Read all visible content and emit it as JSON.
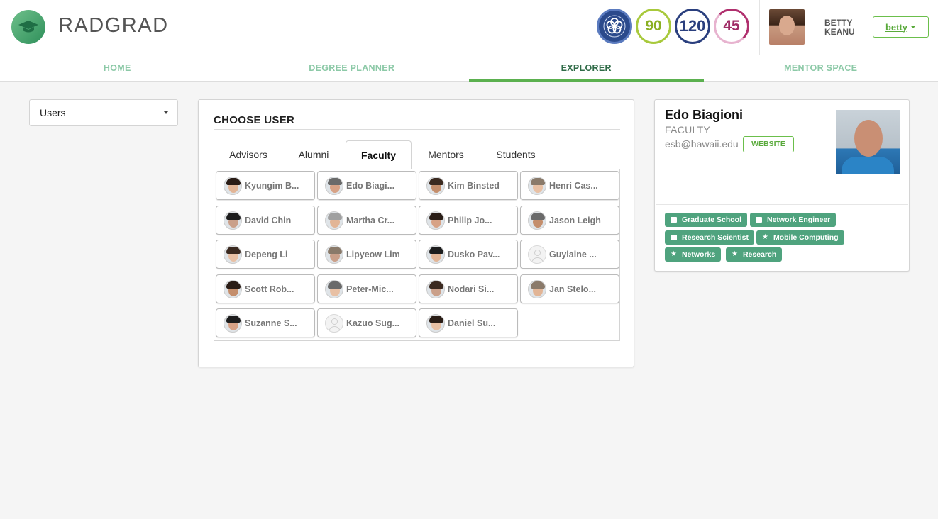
{
  "header": {
    "brand_light": "RAD",
    "brand_bold": "GRAD",
    "badges": {
      "ice_icon": "innovation-competency-experience-flower",
      "innovation": "90",
      "competency": "120",
      "experience": "45"
    },
    "user": {
      "first_name": "BETTY",
      "last_name": "KEANU",
      "button_label": "betty"
    }
  },
  "nav": {
    "items": [
      {
        "label": "HOME"
      },
      {
        "label": "DEGREE PLANNER"
      },
      {
        "label": "EXPLORER"
      },
      {
        "label": "MENTOR SPACE"
      }
    ],
    "active_index": 2
  },
  "explorer_select": {
    "value": "Users"
  },
  "choose_user": {
    "title": "CHOOSE USER",
    "tabs": [
      {
        "label": "Advisors"
      },
      {
        "label": "Alumni"
      },
      {
        "label": "Faculty"
      },
      {
        "label": "Mentors"
      },
      {
        "label": "Students"
      }
    ],
    "active_tab": "Faculty",
    "users": [
      {
        "name": "Kyungim B...",
        "avatar": "photo"
      },
      {
        "name": "Edo Biagi...",
        "avatar": "photo"
      },
      {
        "name": "Kim Binsted",
        "avatar": "photo"
      },
      {
        "name": "Henri Cas...",
        "avatar": "photo"
      },
      {
        "name": "David Chin",
        "avatar": "photo"
      },
      {
        "name": "Martha Cr...",
        "avatar": "photo"
      },
      {
        "name": "Philip Jo...",
        "avatar": "photo"
      },
      {
        "name": "Jason Leigh",
        "avatar": "photo"
      },
      {
        "name": "Depeng Li",
        "avatar": "photo"
      },
      {
        "name": "Lipyeow Lim",
        "avatar": "photo"
      },
      {
        "name": "Dusko Pav...",
        "avatar": "photo"
      },
      {
        "name": "Guylaine ...",
        "avatar": "default-user-icon"
      },
      {
        "name": "Scott Rob...",
        "avatar": "photo"
      },
      {
        "name": "Peter-Mic...",
        "avatar": "photo"
      },
      {
        "name": "Nodari Si...",
        "avatar": "photo"
      },
      {
        "name": "Jan Stelo...",
        "avatar": "photo"
      },
      {
        "name": "Suzanne S...",
        "avatar": "photo"
      },
      {
        "name": "Kazuo Sug...",
        "avatar": "default-user-icon"
      },
      {
        "name": "Daniel Su...",
        "avatar": "photo"
      }
    ]
  },
  "profile": {
    "name": "Edo Biagioni",
    "role": "FACULTY",
    "email": "esb@hawaii.edu",
    "website_label": "WEBSITE",
    "tags": [
      {
        "label": "Graduate School",
        "icon": "briefcase-icon"
      },
      {
        "label": "Network Engineer",
        "icon": "briefcase-icon"
      },
      {
        "label": "Research Scientist",
        "icon": "briefcase-icon"
      },
      {
        "label": "Mobile Computing",
        "icon": "star-icon"
      },
      {
        "label": "Networks",
        "icon": "star-icon"
      },
      {
        "label": "Research",
        "icon": "star-icon"
      }
    ]
  },
  "colors": {
    "accent_green": "#5bb04f",
    "tag_green": "#4fa37e",
    "nav_inactive": "#8cc9a7",
    "nav_active": "#2f6b47"
  }
}
